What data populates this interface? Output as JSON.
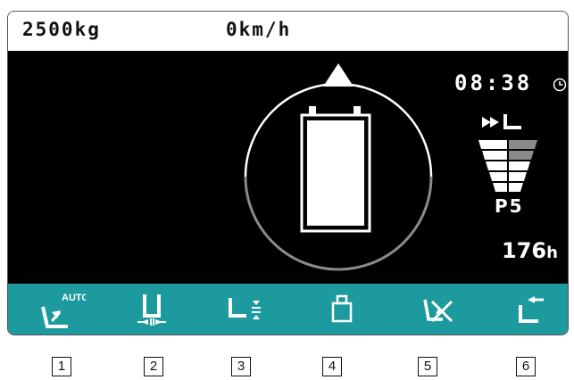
{
  "status_bar": {
    "load": "2500kg",
    "speed": "0km/h"
  },
  "display": {
    "time": "08:38",
    "gear": "P5",
    "hour_meter_value": "176",
    "hour_meter_unit": "h",
    "center_icon": "battery-icon",
    "direction_indicator": "up-arrow-icon",
    "mode_icons": [
      "fast-forward-icon",
      "fork-icon"
    ]
  },
  "softkeys": [
    {
      "icon": "auto-tilt-icon",
      "label": "AUTO"
    },
    {
      "icon": "fork-positioner-icon"
    },
    {
      "icon": "fork-height-icon"
    },
    {
      "icon": "weight-icon"
    },
    {
      "icon": "tilt-disabled-icon"
    },
    {
      "icon": "lift-up-icon"
    }
  ],
  "keys": [
    "1",
    "2",
    "3",
    "4",
    "5",
    "6"
  ],
  "colors": {
    "softbar": "#1d9a9e",
    "screen": "#000000",
    "gauge_ring_gray": "#8a8a8a"
  }
}
